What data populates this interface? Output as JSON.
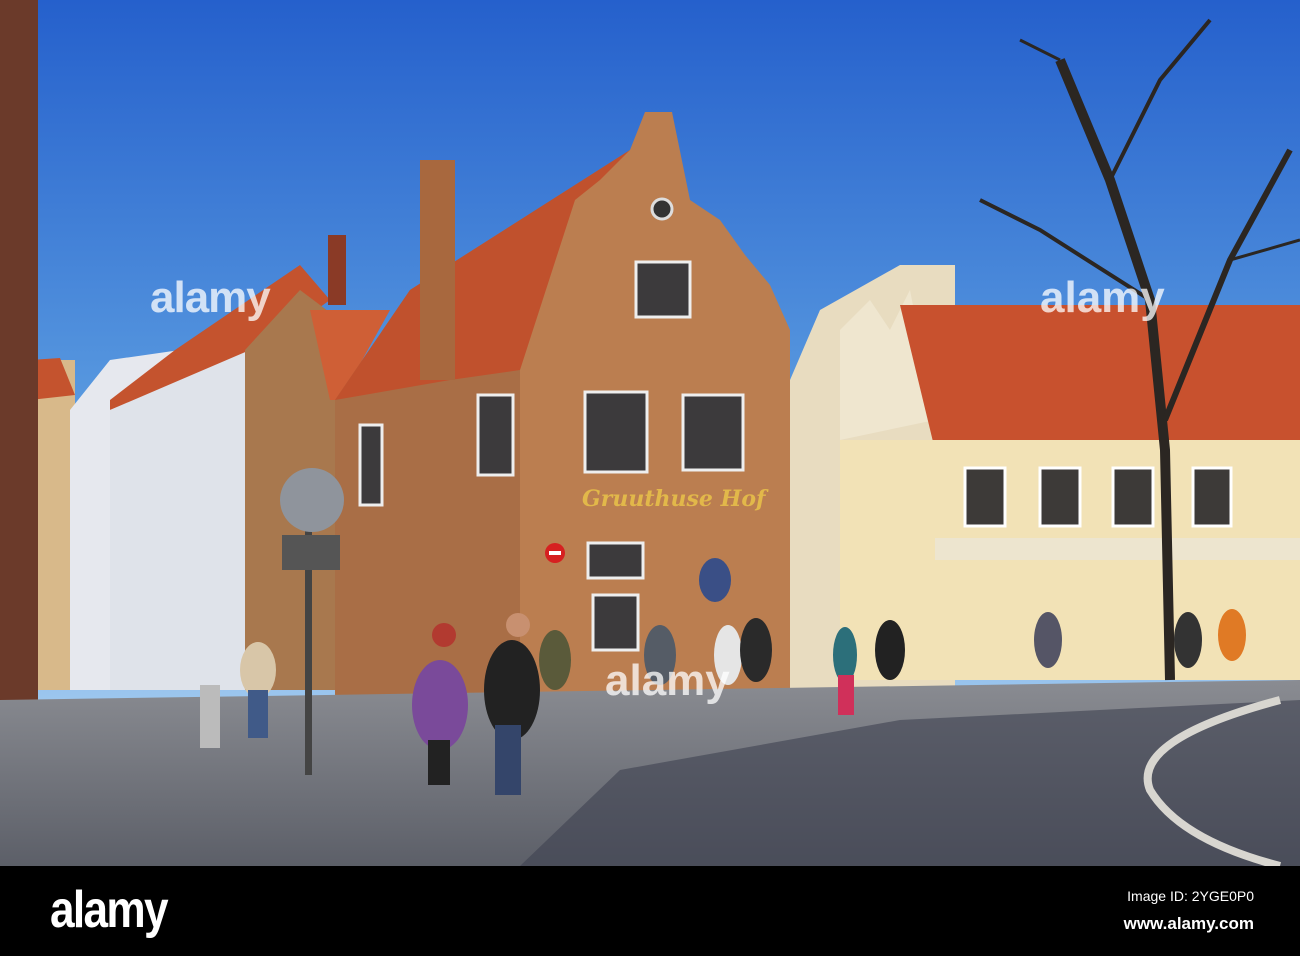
{
  "photo": {
    "storefront_sign": "Gruuthuse Hof",
    "watermark": "alamy"
  },
  "footer": {
    "logo": "alamy",
    "image_id": "Image ID: 2YGE0P0",
    "url": "www.alamy.com"
  },
  "colors": {
    "sky": "#2f6fd4",
    "brick": "#b5784a",
    "roof": "#c4532e",
    "cobblestone": "#6b6f7a",
    "footer": "#000000"
  }
}
